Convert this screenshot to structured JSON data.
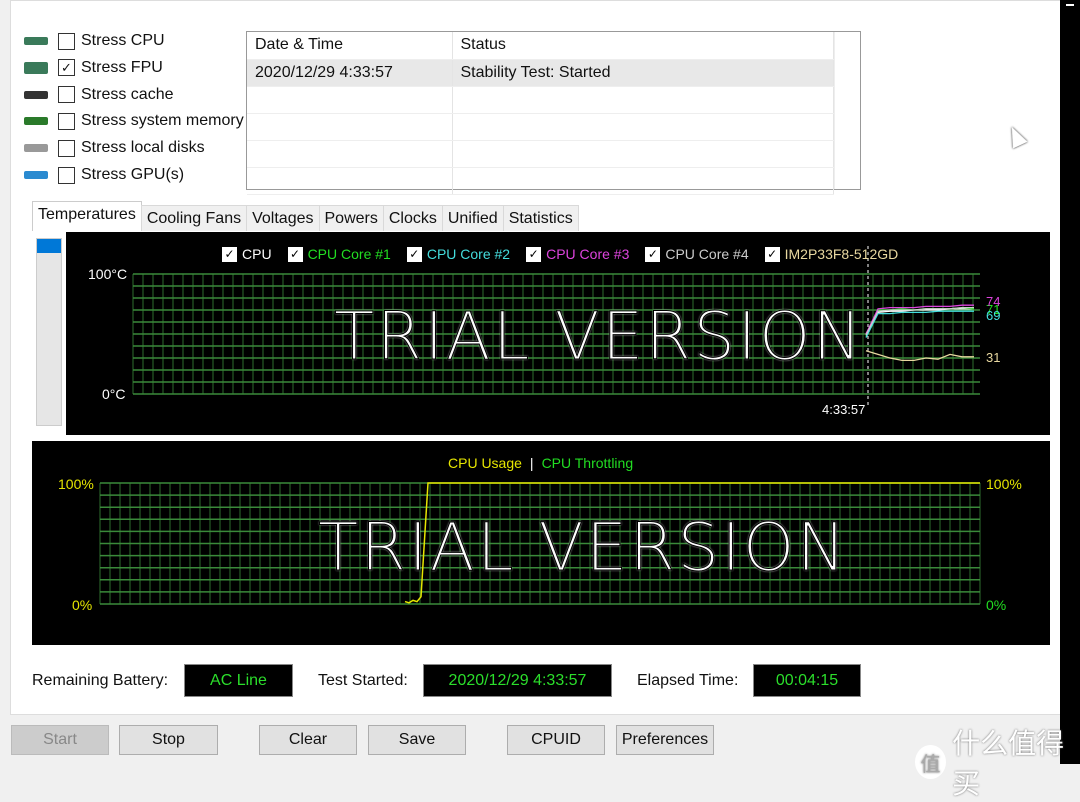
{
  "options": [
    {
      "label": "Stress CPU",
      "checked": false,
      "icon": "cpu-chip-icon"
    },
    {
      "label": "Stress FPU",
      "checked": true,
      "icon": "fpu-123-icon"
    },
    {
      "label": "Stress cache",
      "checked": false,
      "icon": "cache-chip-icon"
    },
    {
      "label": "Stress system memory",
      "checked": false,
      "icon": "memory-module-icon"
    },
    {
      "label": "Stress local disks",
      "checked": false,
      "icon": "disk-drive-icon"
    },
    {
      "label": "Stress GPU(s)",
      "checked": false,
      "icon": "gpu-card-icon"
    }
  ],
  "log": {
    "headers": [
      "Date & Time",
      "Status"
    ],
    "rows": [
      [
        "2020/12/29 4:33:57",
        "Stability Test: Started"
      ]
    ]
  },
  "tabs": [
    "Temperatures",
    "Cooling Fans",
    "Voltages",
    "Powers",
    "Clocks",
    "Unified",
    "Statistics"
  ],
  "watermark": "TRIAL VERSION",
  "chart_data": [
    {
      "type": "line",
      "ylim": [
        0,
        100
      ],
      "y_top_label": "100°C",
      "y_bottom_label": "0°C",
      "x_marker_label": "4:33:57",
      "grid": true,
      "series": [
        {
          "name": "CPU",
          "color": "#ffffff",
          "end_label": "",
          "values": [
            50,
            68,
            69,
            69,
            70,
            70,
            70,
            71,
            71,
            71
          ]
        },
        {
          "name": "CPU Core #1",
          "color": "#22dd22",
          "end_label": "71",
          "values": [
            48,
            70,
            70,
            71,
            70,
            71,
            71,
            71,
            72,
            71
          ]
        },
        {
          "name": "CPU Core #2",
          "color": "#44dddd",
          "end_label": "69",
          "values": [
            47,
            67,
            67,
            68,
            68,
            68,
            69,
            69,
            69,
            69
          ]
        },
        {
          "name": "CPU Core #3",
          "color": "#dd44dd",
          "end_label": "74",
          "values": [
            50,
            71,
            72,
            72,
            72,
            73,
            73,
            73,
            74,
            74
          ]
        },
        {
          "name": "CPU Core #4",
          "color": "#cccccc",
          "end_label": "",
          "values": [
            49,
            69,
            70,
            70,
            70,
            71,
            71,
            71,
            72,
            72
          ]
        },
        {
          "name": "IM2P33F8-512GD",
          "color": "#e8d8a0",
          "end_label": "31",
          "values": [
            36,
            33,
            30,
            28,
            28,
            30,
            29,
            33,
            31,
            31
          ]
        }
      ]
    },
    {
      "type": "line",
      "ylim": [
        0,
        100
      ],
      "y_left_top": "100%",
      "y_left_bottom": "0%",
      "y_right_top": "100%",
      "y_right_bottom": "0%",
      "grid": true,
      "series": [
        {
          "name": "CPU Usage",
          "color": "#e6e600",
          "values": [
            2,
            1,
            3,
            2,
            6,
            100,
            100,
            100
          ]
        },
        {
          "name": "CPU Throttling",
          "color": "#22dd22",
          "values": [
            0,
            0,
            0,
            0,
            0,
            0,
            0,
            0
          ]
        }
      ]
    }
  ],
  "status": {
    "battery_label": "Remaining Battery:",
    "battery_value": "AC Line",
    "started_label": "Test Started:",
    "started_value": "2020/12/29 4:33:57",
    "elapsed_label": "Elapsed Time:",
    "elapsed_value": "00:04:15"
  },
  "buttons": {
    "start": "Start",
    "stop": "Stop",
    "clear": "Clear",
    "save": "Save",
    "cpuid": "CPUID",
    "preferences": "Preferences"
  },
  "brand": {
    "badge": "值",
    "text": "什么值得买"
  }
}
